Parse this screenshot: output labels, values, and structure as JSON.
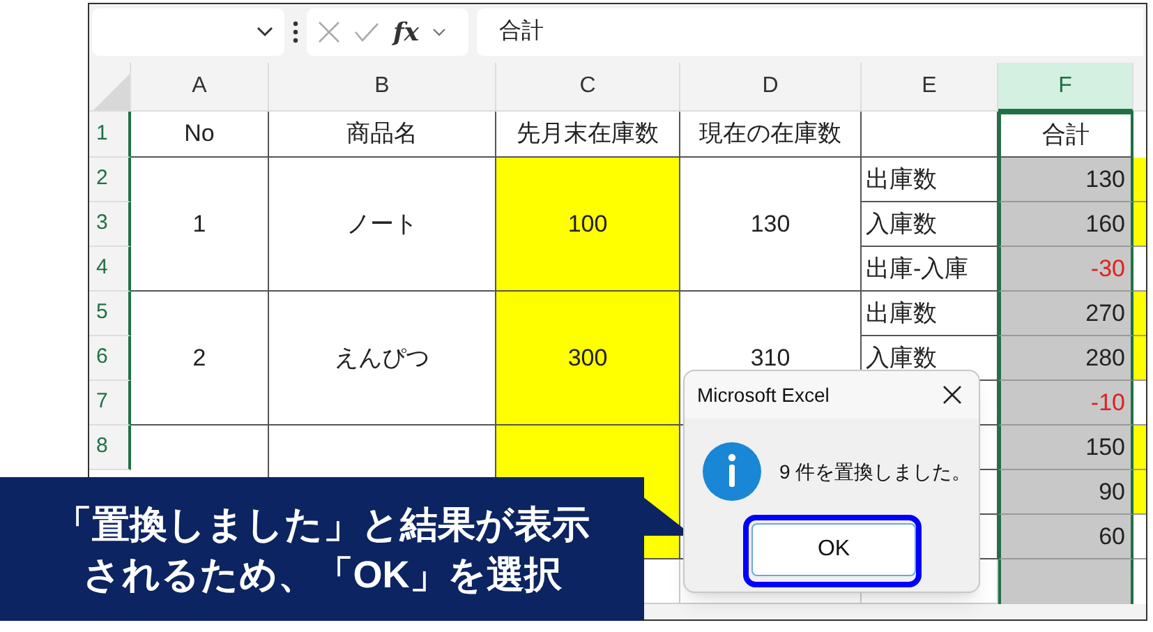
{
  "formula_bar": {
    "function_label": "fx",
    "formula": "合計"
  },
  "columns": [
    {
      "label": "A",
      "selected": false
    },
    {
      "label": "B",
      "selected": false
    },
    {
      "label": "C",
      "selected": false
    },
    {
      "label": "D",
      "selected": false
    },
    {
      "label": "E",
      "selected": false
    },
    {
      "label": "F",
      "selected": true
    }
  ],
  "row_numbers": [
    "1",
    "2",
    "3",
    "4",
    "5",
    "6",
    "7",
    "8"
  ],
  "header_row": {
    "no": "No",
    "name": "商品名",
    "previous_stock": "先月末在庫数",
    "current_stock": "現在の在庫数",
    "total": "合計"
  },
  "groups": [
    {
      "no": "1",
      "name": "ノート",
      "previous_stock": "100",
      "current_stock": "130",
      "lines": [
        {
          "label": "出庫数",
          "total": "130",
          "negative": false,
          "next_cell_filled": true
        },
        {
          "label": "入庫数",
          "total": "160",
          "negative": false,
          "next_cell_filled": true
        },
        {
          "label": "出庫-入庫",
          "total": "-30",
          "negative": true,
          "next_cell_filled": false
        }
      ]
    },
    {
      "no": "2",
      "name": "えんぴつ",
      "previous_stock": "300",
      "current_stock": "310",
      "lines": [
        {
          "label": "出庫数",
          "total": "270",
          "negative": false,
          "next_cell_filled": true
        },
        {
          "label": "入庫数",
          "total": "280",
          "negative": false,
          "next_cell_filled": true
        },
        {
          "total": "-10",
          "negative": true,
          "next_cell_filled": false
        }
      ]
    },
    {
      "lines": [
        {
          "total": "150",
          "negative": false,
          "next_cell_filled": true
        },
        {
          "total": "90",
          "negative": false,
          "next_cell_filled": true
        },
        {
          "total": "60",
          "negative": false,
          "next_cell_filled": false
        }
      ]
    }
  ],
  "dialog": {
    "title": "Microsoft Excel",
    "message": "9 件を置換しました。",
    "button": "OK"
  },
  "callout": {
    "lines": [
      "「置換しました」と結果が表示",
      "されるため、「OK」を選択"
    ]
  }
}
